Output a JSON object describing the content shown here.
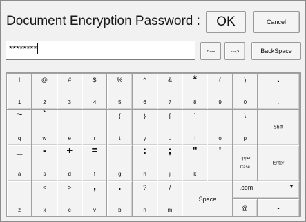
{
  "dialog": {
    "title": "Document Encryption Password :",
    "ok_label": "OK",
    "cancel_label": "Cancel",
    "password_value": "********",
    "left_arrow_label": "<---",
    "right_arrow_label": "--->",
    "backspace_label": "BackSpace"
  },
  "keyboard": {
    "rows": [
      [
        {
          "top": "!",
          "bottom": "1"
        },
        {
          "top": "@",
          "bottom": "2"
        },
        {
          "top": "#",
          "bottom": "3"
        },
        {
          "top": "$",
          "bottom": "4"
        },
        {
          "top": "%",
          "bottom": "5"
        },
        {
          "top": "^",
          "bottom": "6"
        },
        {
          "top": "&",
          "bottom": "7"
        },
        {
          "top": "*",
          "bottom": "8"
        },
        {
          "top": "(",
          "bottom": "9"
        },
        {
          "top": ")",
          "bottom": "0"
        },
        {
          "top": ".",
          "bottom": "."
        }
      ],
      [
        {
          "top": "~",
          "bottom": "q"
        },
        {
          "top": "`",
          "bottom": "w"
        },
        {
          "top": "",
          "bottom": "e"
        },
        {
          "top": "",
          "bottom": "r"
        },
        {
          "top": "{",
          "bottom": "t"
        },
        {
          "top": "}",
          "bottom": "y"
        },
        {
          "top": "[",
          "bottom": "u"
        },
        {
          "top": "]",
          "bottom": "i"
        },
        {
          "top": "|",
          "bottom": "o"
        },
        {
          "top": "\\",
          "bottom": "p"
        },
        {
          "label": "Shift"
        }
      ],
      [
        {
          "top": "_",
          "bottom": "a"
        },
        {
          "top": "-",
          "bottom": "s"
        },
        {
          "top": "+",
          "bottom": "d"
        },
        {
          "top": "=",
          "bottom": "f"
        },
        {
          "top": "",
          "bottom": "g"
        },
        {
          "top": ":",
          "bottom": "h"
        },
        {
          "top": ";",
          "bottom": "j"
        },
        {
          "top": "\"",
          "bottom": "k"
        },
        {
          "top": "'",
          "bottom": "l"
        },
        {
          "line1": "Upper",
          "line2": "Case"
        },
        {
          "label": "Enter"
        }
      ],
      [
        {
          "top": "",
          "bottom": "z"
        },
        {
          "top": "<",
          "bottom": "x"
        },
        {
          "top": ">",
          "bottom": "c"
        },
        {
          "top": ",",
          "bottom": "v"
        },
        {
          "top": ".",
          "bottom": "b"
        },
        {
          "top": "?",
          "bottom": "n"
        },
        {
          "top": "/",
          "bottom": "m"
        }
      ]
    ],
    "space_label": "Space",
    "dotcom_label": ".com",
    "at_label": "@",
    "dash_label": "-"
  }
}
